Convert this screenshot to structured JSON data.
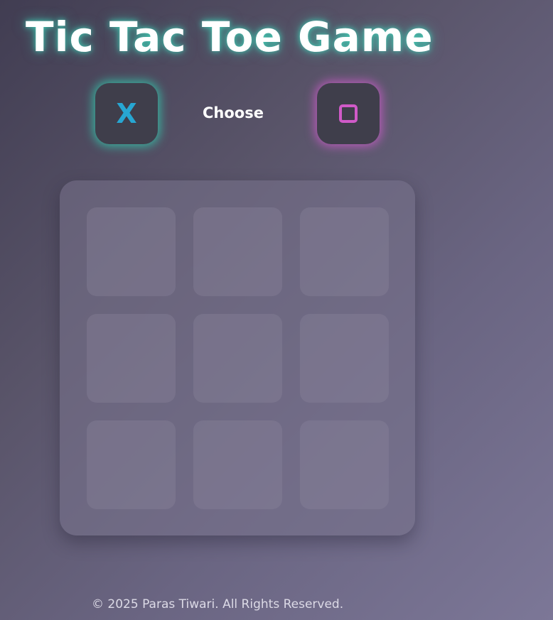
{
  "title": "Tic Tac Toe Game",
  "chooser": {
    "label": "Choose",
    "x_symbol": "X",
    "o_symbol": "O",
    "x_color": "#27a6d2",
    "o_color": "#d05ac8",
    "x_glow": "#30d6b4",
    "o_glow": "#d65cd2"
  },
  "board": {
    "cells": [
      "",
      "",
      "",
      "",
      "",
      "",
      "",
      "",
      ""
    ]
  },
  "footer": "© 2025 Paras Tiwari. All Rights Reserved."
}
